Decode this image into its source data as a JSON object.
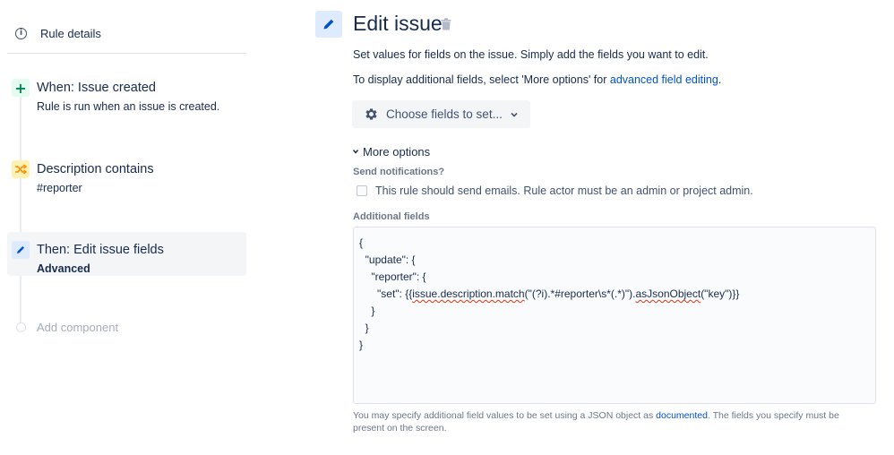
{
  "sidebar": {
    "rule_details": "Rule details",
    "steps": [
      {
        "title": "When: Issue created",
        "sub": "Rule is run when an issue is created.",
        "type": "trigger",
        "icon": "plus-icon",
        "color": "#00875a"
      },
      {
        "title": "Description contains",
        "sub": "#reporter",
        "type": "condition",
        "icon": "shuffle-icon",
        "color": "#ff8b00"
      },
      {
        "title": "Then: Edit issue fields",
        "sub": "Advanced",
        "type": "action",
        "icon": "pencil-icon",
        "color": "#0052cc",
        "selected": true
      }
    ],
    "add_component": "Add component"
  },
  "main": {
    "title": "Edit issue",
    "desc1": "Set values for fields on the issue. Simply add the fields you want to edit.",
    "desc2_prefix": "To display additional fields, select 'More options' for ",
    "desc2_link": "advanced field editing",
    "desc2_suffix": ".",
    "choose_fields": "Choose fields to set...",
    "more_options": "More options",
    "send_notifications_label": "Send notifications?",
    "send_notifications_text": "This rule should send emails. Rule actor must be an admin or project admin.",
    "send_notifications_checked": false,
    "additional_fields_label": "Additional fields",
    "json_lines": [
      "{",
      "  \"update\": {",
      "    \"reporter\": {",
      "      \"set\": {{issue.description.match(\"(?i).*#reporter\\s*(.*)\").asJsonObject(\"key\")}}",
      "    }",
      "  }",
      "}"
    ],
    "help_prefix": "You may specify additional field values to be set using a JSON object as ",
    "help_link": "documented",
    "help_suffix": ". The fields you specify must be present on the screen."
  },
  "colors": {
    "link": "#0052cc",
    "text": "#172b4d",
    "subtle": "#6b778c"
  }
}
